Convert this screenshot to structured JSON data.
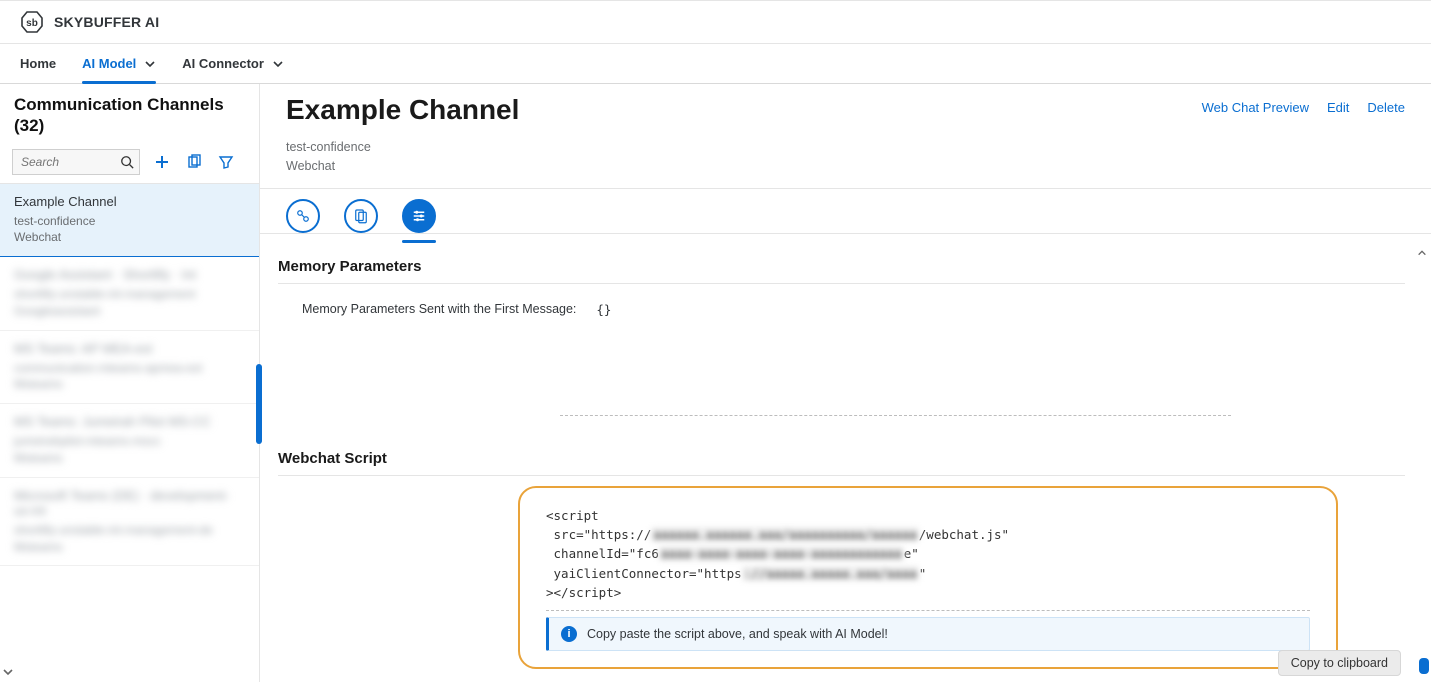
{
  "brand": {
    "name": "SKYBUFFER AI"
  },
  "nav": {
    "home": "Home",
    "ai_model": "AI Model",
    "ai_connector": "AI Connector"
  },
  "sidebar": {
    "title_line1": "Communication Channels",
    "count_label": "(32)",
    "search_placeholder": "Search",
    "items": [
      {
        "title": "Example Channel",
        "sub1": "test-confidence",
        "sub2": "Webchat",
        "selected": true
      },
      {
        "title": "Google Assistant · Shortlify · Int",
        "sub1": "shortlify-unstable-int-management",
        "sub2": "Googleassistant",
        "blurred": true
      },
      {
        "title": "MS Teams: AP MEA-ext",
        "sub1": "communication-mteams-apmea-ext",
        "sub2": "Msteams",
        "blurred": true
      },
      {
        "title": "MS Teams: Jumeirah Pilot MS-CC",
        "sub1": "jumeirahpilot-mteams-mscc",
        "sub2": "Msteams",
        "blurred": true
      },
      {
        "title": "Microsoft Teams (DE) · development-us-int",
        "sub1": "shortlify-unstable-int-management-de",
        "sub2": "Msteams",
        "blurred": true
      }
    ]
  },
  "page": {
    "title": "Example Channel",
    "meta1": "test-confidence",
    "meta2": "Webchat",
    "actions": {
      "preview": "Web Chat Preview",
      "edit": "Edit",
      "delete": "Delete"
    }
  },
  "sections": {
    "memory": {
      "header": "Memory Parameters",
      "row_label": "Memory Parameters Sent with the First Message:",
      "row_value": "{}"
    },
    "script": {
      "header": "Webchat Script",
      "code_lines": [
        "<script",
        " src=\"https://",
        "/webchat.js\"",
        " channelId=\"fc6",
        "e\"",
        " yaiClientConnector=\"https",
        "\"",
        "></script>"
      ],
      "hint": "Copy paste the script above, and speak with AI Model!",
      "copy_button": "Copy to clipboard"
    }
  }
}
